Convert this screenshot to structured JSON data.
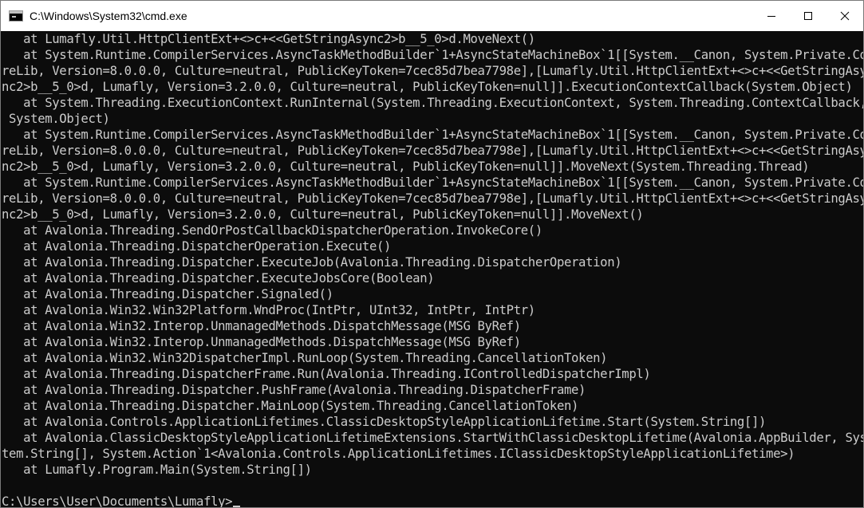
{
  "window": {
    "title": "C:\\Windows\\System32\\cmd.exe",
    "icon": "console-app-icon"
  },
  "titlebar": {
    "minimize_icon": "minimize-icon",
    "maximize_icon": "maximize-icon",
    "close_icon": "close-icon"
  },
  "console": {
    "lines": [
      "   at Lumafly.Util.HttpClientExt+<>c+<<GetStringAsync2>b__5_0>d.MoveNext()",
      "   at System.Runtime.CompilerServices.AsyncTaskMethodBuilder`1+AsyncStateMachineBox`1[[System.__Canon, System.Private.Co",
      "reLib, Version=8.0.0.0, Culture=neutral, PublicKeyToken=7cec85d7bea7798e],[Lumafly.Util.HttpClientExt+<>c+<<GetStringAsy",
      "nc2>b__5_0>d, Lumafly, Version=3.2.0.0, Culture=neutral, PublicKeyToken=null]].ExecutionContextCallback(System.Object)",
      "   at System.Threading.ExecutionContext.RunInternal(System.Threading.ExecutionContext, System.Threading.ContextCallback,",
      " System.Object)",
      "   at System.Runtime.CompilerServices.AsyncTaskMethodBuilder`1+AsyncStateMachineBox`1[[System.__Canon, System.Private.Co",
      "reLib, Version=8.0.0.0, Culture=neutral, PublicKeyToken=7cec85d7bea7798e],[Lumafly.Util.HttpClientExt+<>c+<<GetStringAsy",
      "nc2>b__5_0>d, Lumafly, Version=3.2.0.0, Culture=neutral, PublicKeyToken=null]].MoveNext(System.Threading.Thread)",
      "   at System.Runtime.CompilerServices.AsyncTaskMethodBuilder`1+AsyncStateMachineBox`1[[System.__Canon, System.Private.Co",
      "reLib, Version=8.0.0.0, Culture=neutral, PublicKeyToken=7cec85d7bea7798e],[Lumafly.Util.HttpClientExt+<>c+<<GetStringAsy",
      "nc2>b__5_0>d, Lumafly, Version=3.2.0.0, Culture=neutral, PublicKeyToken=null]].MoveNext()",
      "   at Avalonia.Threading.SendOrPostCallbackDispatcherOperation.InvokeCore()",
      "   at Avalonia.Threading.DispatcherOperation.Execute()",
      "   at Avalonia.Threading.Dispatcher.ExecuteJob(Avalonia.Threading.DispatcherOperation)",
      "   at Avalonia.Threading.Dispatcher.ExecuteJobsCore(Boolean)",
      "   at Avalonia.Threading.Dispatcher.Signaled()",
      "   at Avalonia.Win32.Win32Platform.WndProc(IntPtr, UInt32, IntPtr, IntPtr)",
      "   at Avalonia.Win32.Interop.UnmanagedMethods.DispatchMessage(MSG ByRef)",
      "   at Avalonia.Win32.Interop.UnmanagedMethods.DispatchMessage(MSG ByRef)",
      "   at Avalonia.Win32.Win32DispatcherImpl.RunLoop(System.Threading.CancellationToken)",
      "   at Avalonia.Threading.DispatcherFrame.Run(Avalonia.Threading.IControlledDispatcherImpl)",
      "   at Avalonia.Threading.Dispatcher.PushFrame(Avalonia.Threading.DispatcherFrame)",
      "   at Avalonia.Threading.Dispatcher.MainLoop(System.Threading.CancellationToken)",
      "   at Avalonia.Controls.ApplicationLifetimes.ClassicDesktopStyleApplicationLifetime.Start(System.String[])",
      "   at Avalonia.ClassicDesktopStyleApplicationLifetimeExtensions.StartWithClassicDesktopLifetime(Avalonia.AppBuilder, Sys",
      "tem.String[], System.Action`1<Avalonia.Controls.ApplicationLifetimes.IClassicDesktopStyleApplicationLifetime>)",
      "   at Lumafly.Program.Main(System.String[])",
      ""
    ],
    "prompt": "C:\\Users\\User\\Documents\\Lumafly>",
    "background": "#0c0c0c",
    "foreground": "#cccccc"
  }
}
